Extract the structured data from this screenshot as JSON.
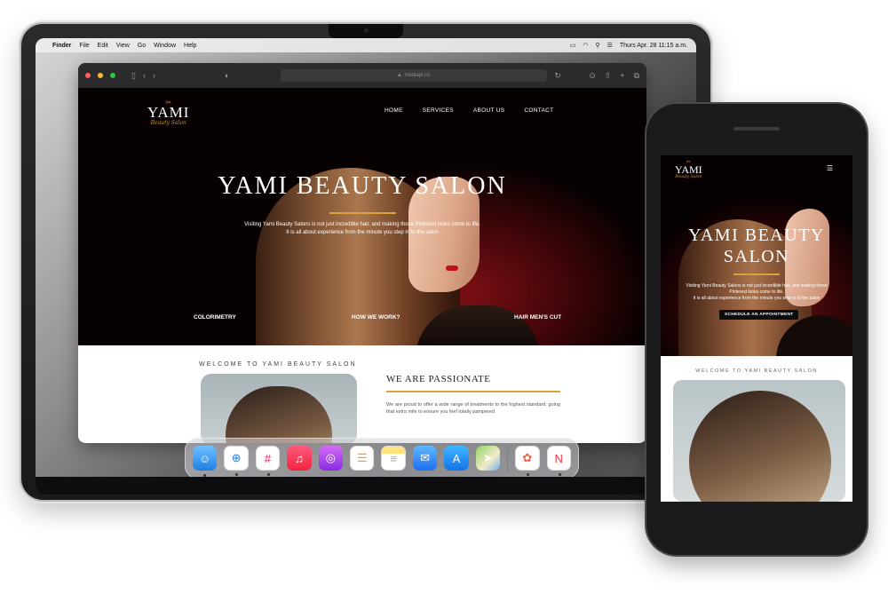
{
  "menubar": {
    "app_name": "Finder",
    "menus": [
      "File",
      "Edit",
      "View",
      "Go",
      "Window",
      "Help"
    ],
    "clock": "Thurs Apr. 28  11:15 a.m."
  },
  "browser": {
    "url": "mediapi.co"
  },
  "site": {
    "logo_main": "YAMI",
    "logo_sub": "Beauty Salon",
    "nav": [
      "HOME",
      "SERVICES",
      "ABOUT US",
      "CONTACT"
    ],
    "hero_title": "YAMI BEAUTY SALON",
    "hero_text_line1": "Visiting Yami Beauty Salons is not just incredible hair, and making those Pinterest looks come to life.",
    "hero_text_line2": "It is all about experience from the minute you step in to the salon",
    "hero_links": [
      "COLORIMETRY",
      "HOW WE WORK?",
      "HAIR MEN'S CUT"
    ],
    "welcome_title": "WELCOME TO YAMI BEAUTY SALON",
    "passion_title": "WE ARE PASSIONATE",
    "passion_text": "We are proud to offer a wide range of treatments to the highest standard, going that extra mile to ensure you feel totally pampered"
  },
  "dock": {
    "apps": [
      "finder-icon",
      "safari-icon",
      "slack-icon",
      "music-icon",
      "podcasts-icon",
      "reminders-icon",
      "notes-icon",
      "mail-icon",
      "app-store-icon",
      "maps-icon",
      "photos-icon",
      "news-icon"
    ]
  },
  "phone": {
    "logo_main": "YAMI",
    "logo_sub": "Beauty Salon",
    "hero_title_line1": "YAMI BEAUTY",
    "hero_title_line2": "SALON",
    "hero_text_line1": "Visiting Yami Beauty Salons is not just incredible hair, and making those",
    "hero_text_line2": "Pinterest looks come to life.",
    "hero_text_line3": "It is all about experience from the minute you step in to the salon",
    "cta_button": "SCHEDULE AN APPOINTMENT",
    "welcome_title": "WELCOME TO YAMI BEAUTY SALON"
  },
  "colors": {
    "accent_gold": "#d9a23a",
    "hero_dark_red": "#7a0f14"
  }
}
